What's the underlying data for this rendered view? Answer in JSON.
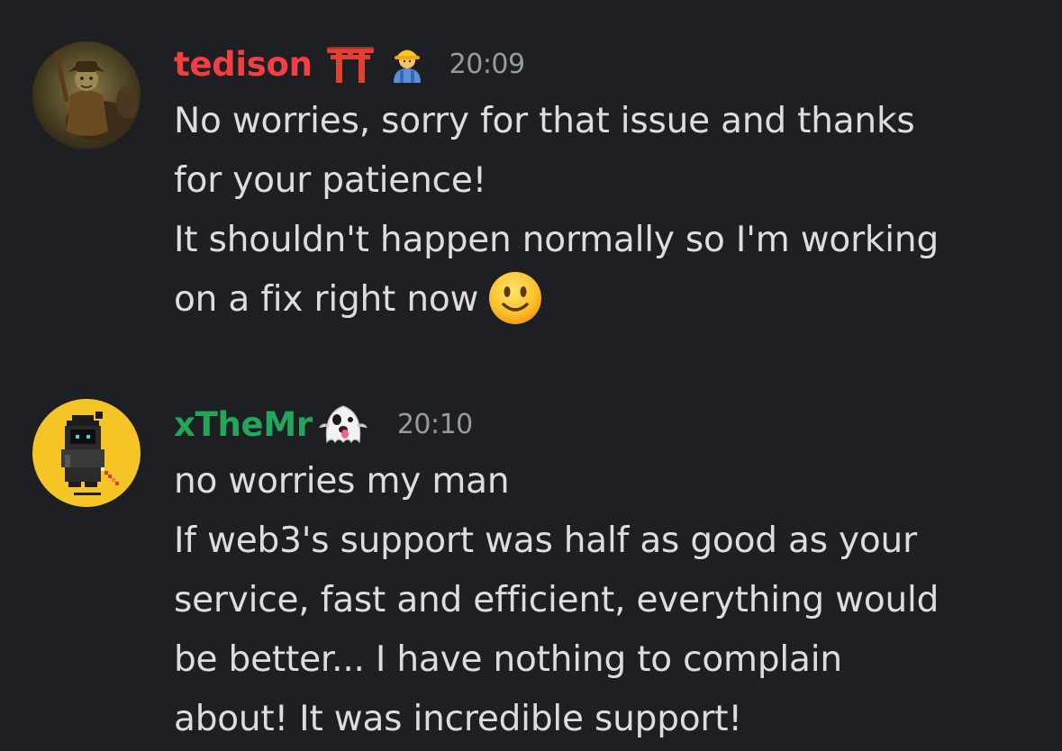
{
  "messages": [
    {
      "author": "tedison",
      "author_color": "#f23f43",
      "badges": [
        "torii-gate-emoji",
        "construction-worker-emoji"
      ],
      "timestamp": "20:09",
      "lines": [
        "No worries, sorry for that issue and thanks",
        "for your patience!",
        "It shouldn't happen normally so I'm working",
        "on a fix right now"
      ],
      "trailing_emoji": "slightly-smiling-face-emoji"
    },
    {
      "author": "xTheMr",
      "author_color": "#23a55a",
      "badges": [
        "ghost-emoji"
      ],
      "timestamp": "20:10",
      "lines": [
        "no worries my man",
        "If web3's support was half as good as your",
        "service, fast and efficient, everything would",
        "be better... I have nothing to complain",
        "about! It was incredible support!"
      ]
    }
  ],
  "colors": {
    "background": "#1e1f22",
    "text": "#dbdee1",
    "timestamp": "#949ba4"
  }
}
